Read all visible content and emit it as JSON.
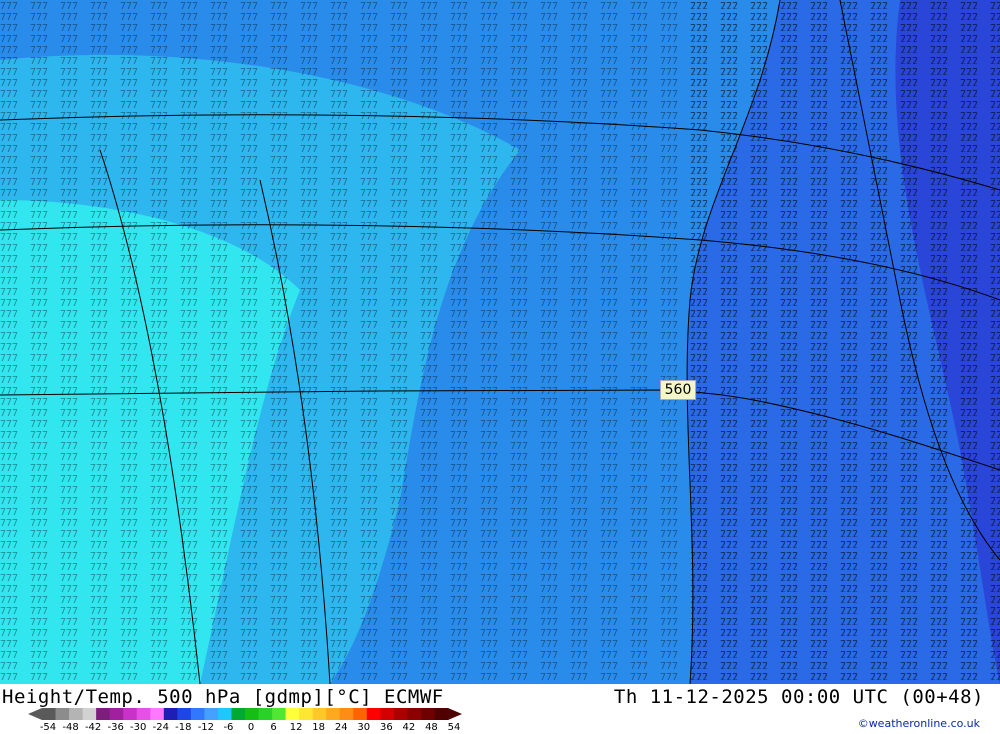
{
  "title": {
    "left": "Height/Temp. 500 hPa [gdmp][°C] ECMWF",
    "right": "Th 11-12-2025 00:00 UTC (00+48)"
  },
  "credit": "©weatheronline.co.uk",
  "contour_label": "560",
  "legend": {
    "tick_labels": [
      "-54",
      "-48",
      "-42",
      "-36",
      "-30",
      "-24",
      "-18",
      "-12",
      "-6",
      "0",
      "6",
      "12",
      "18",
      "24",
      "30",
      "36",
      "42",
      "48",
      "54"
    ],
    "colors": [
      "#5a5a5a",
      "#8c8c8c",
      "#b4b4b4",
      "#d2d2d2",
      "#7d1e7d",
      "#a020a0",
      "#c832c8",
      "#e650e6",
      "#ff78ff",
      "#1e1eb4",
      "#1e46e6",
      "#3278ff",
      "#46a0ff",
      "#1ec8ff",
      "#00aa32",
      "#14be14",
      "#28d228",
      "#50e632",
      "#ffff3c",
      "#ffe632",
      "#ffc828",
      "#ffaa1e",
      "#ff8c14",
      "#ff6400",
      "#ff0000",
      "#d20000",
      "#aa0000",
      "#8c0000",
      "#6e0000",
      "#500000"
    ]
  },
  "map": {
    "colors": {
      "cyan": "#32e6f0",
      "light_blue": "#2eb6ee",
      "mid_blue": "#2a8cea",
      "blue": "#2a6ae6",
      "deep_blue": "#2a46d8",
      "contour": "#000000"
    }
  }
}
